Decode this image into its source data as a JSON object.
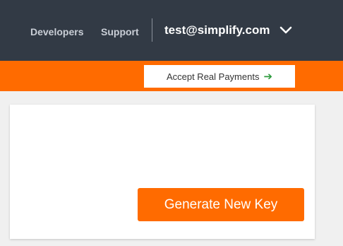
{
  "header": {
    "nav": {
      "developers": "Developers",
      "support": "Support"
    },
    "account_email": "test@simplify.com",
    "account_menu_icon": "chevron-down-icon",
    "bg_color": "#323a45"
  },
  "banner": {
    "accept_payments_label": "Accept Real Payments",
    "accept_payments_icon": "arrow-right-icon",
    "arrow_glyph": "➔",
    "bg_color": "#ff6b00",
    "arrow_color": "#2e9b3e"
  },
  "card": {
    "generate_key_label": "Generate New Key",
    "button_color": "#ff6b00"
  }
}
